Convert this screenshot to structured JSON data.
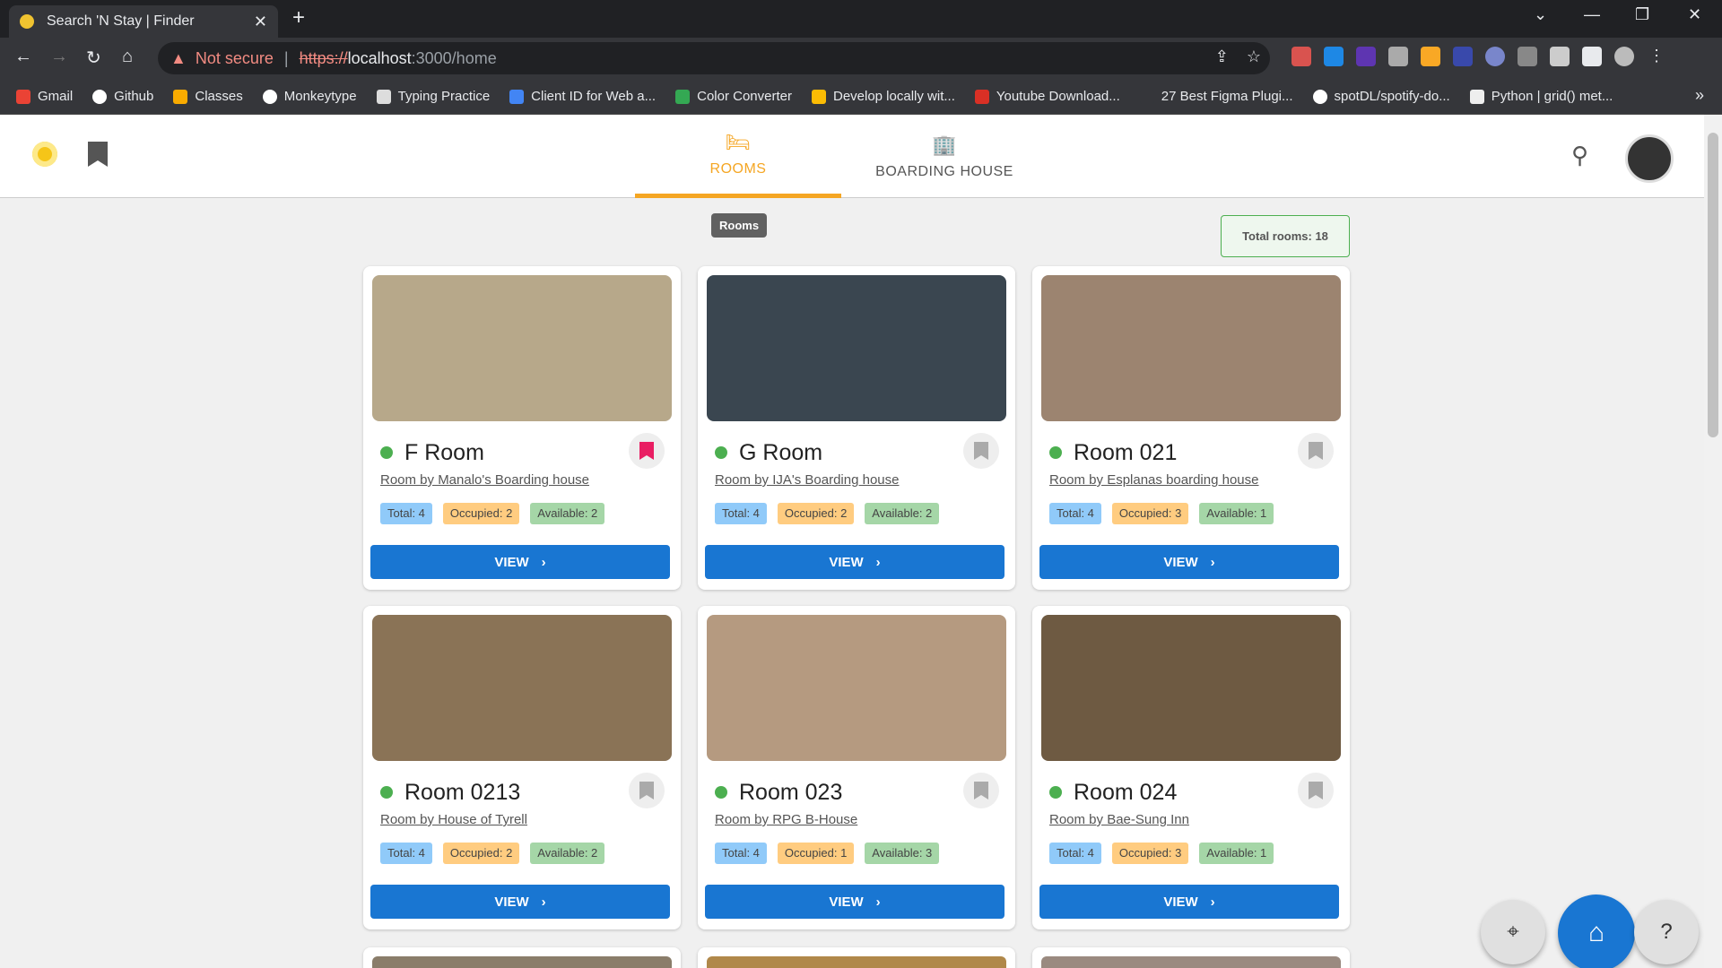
{
  "browser": {
    "tab_title": "Search 'N Stay | Finder",
    "security": "Not secure",
    "url_scheme": "https://",
    "url_host": "localhost",
    "url_path": ":3000/home",
    "bookmarks": [
      "Gmail",
      "Github",
      "Classes",
      "Monkeytype",
      "Typing Practice",
      "Client ID for Web a...",
      "Color Converter",
      "Develop locally wit...",
      "Youtube Download...",
      "27 Best Figma Plugi...",
      "spotDL/spotify-do...",
      "Python | grid() met..."
    ]
  },
  "app": {
    "tabs": [
      {
        "label": "ROOMS",
        "icon": "bed-icon",
        "active": true
      },
      {
        "label": "BOARDING HOUSE",
        "icon": "building-icon",
        "active": false
      }
    ],
    "section_chip": "Rooms",
    "total_rooms": "Total rooms: 18",
    "view_label": "VIEW",
    "rooms": [
      {
        "name": "F Room",
        "owner": "Room by Manalo's Boarding house",
        "total": "Total: 4",
        "occupied": "Occupied: 2",
        "available": "Available: 2",
        "bookmarked": true,
        "photo_color": "#b7a88a"
      },
      {
        "name": "G Room",
        "owner": "Room by IJA's Boarding house",
        "total": "Total: 4",
        "occupied": "Occupied: 2",
        "available": "Available: 2",
        "bookmarked": false,
        "photo_color": "#3a4650"
      },
      {
        "name": "Room 021",
        "owner": "Room by Esplanas boarding house",
        "total": "Total: 4",
        "occupied": "Occupied: 3",
        "available": "Available: 1",
        "bookmarked": false,
        "photo_color": "#9c8470"
      },
      {
        "name": "Room 0213",
        "owner": "Room by House of Tyrell",
        "total": "Total: 4",
        "occupied": "Occupied: 2",
        "available": "Available: 2",
        "bookmarked": false,
        "photo_color": "#8a7356"
      },
      {
        "name": "Room 023",
        "owner": "Room by RPG B-House",
        "total": "Total: 4",
        "occupied": "Occupied: 1",
        "available": "Available: 3",
        "bookmarked": false,
        "photo_color": "#b59a80"
      },
      {
        "name": "Room 024",
        "owner": "Room by Bae-Sung Inn",
        "total": "Total: 4",
        "occupied": "Occupied: 3",
        "available": "Available: 1",
        "bookmarked": false,
        "photo_color": "#6e5a42"
      }
    ]
  },
  "colors": {
    "accent": "#f5a623",
    "primary": "#1976d2",
    "status_dot": "#4caf50"
  }
}
